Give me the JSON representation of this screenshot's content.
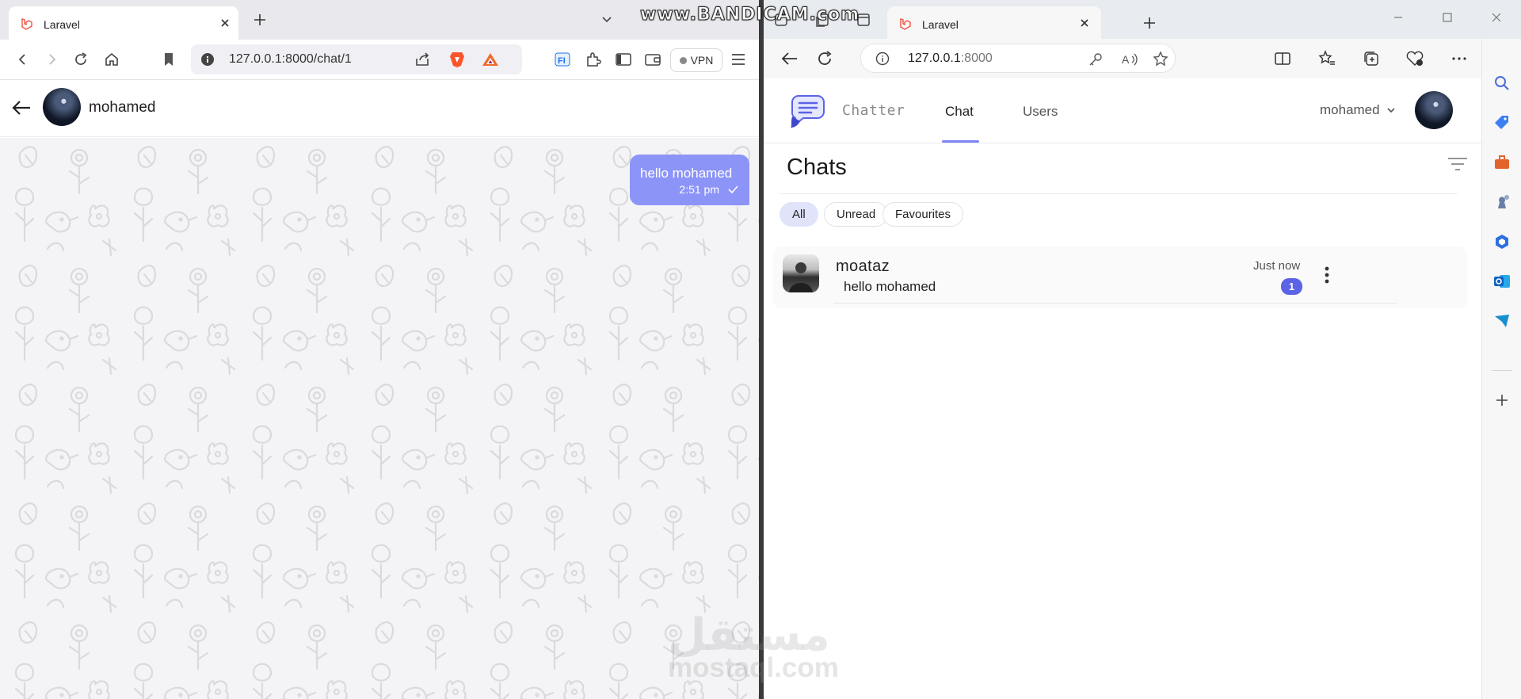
{
  "left_window": {
    "tab_title": "Laravel",
    "url": "127.0.0.1:8000/chat/1",
    "vpn_label": "VPN",
    "chat_header": {
      "contact_name": "mohamed"
    },
    "messages": [
      {
        "text": "hello mohamed",
        "time": "2:51 pm",
        "status_icon": "check-icon",
        "direction": "outgoing"
      }
    ]
  },
  "right_window": {
    "tab_title": "Laravel",
    "url_host": "127.0.0.1",
    "url_port": ":8000",
    "app": {
      "brand": "Chatter",
      "nav": {
        "chat": "Chat",
        "users": "Users",
        "user_menu": "mohamed"
      },
      "chats_title": "Chats",
      "filters": [
        "All",
        "Unread",
        "Favourites"
      ],
      "conversations": [
        {
          "name": "moataz",
          "last_message": "hello mohamed",
          "time": "Just now",
          "unread": "1"
        }
      ]
    }
  },
  "overlays": {
    "recorder_watermark": "www.BANDICAM.com",
    "site_watermark_arabic": "مستقل",
    "site_watermark": "mostaql.com"
  },
  "colors": {
    "accent": "#7c85f3",
    "bubble": "#8c94f7",
    "badge": "#5b63e6",
    "active_filter": "#dfe4fb"
  }
}
